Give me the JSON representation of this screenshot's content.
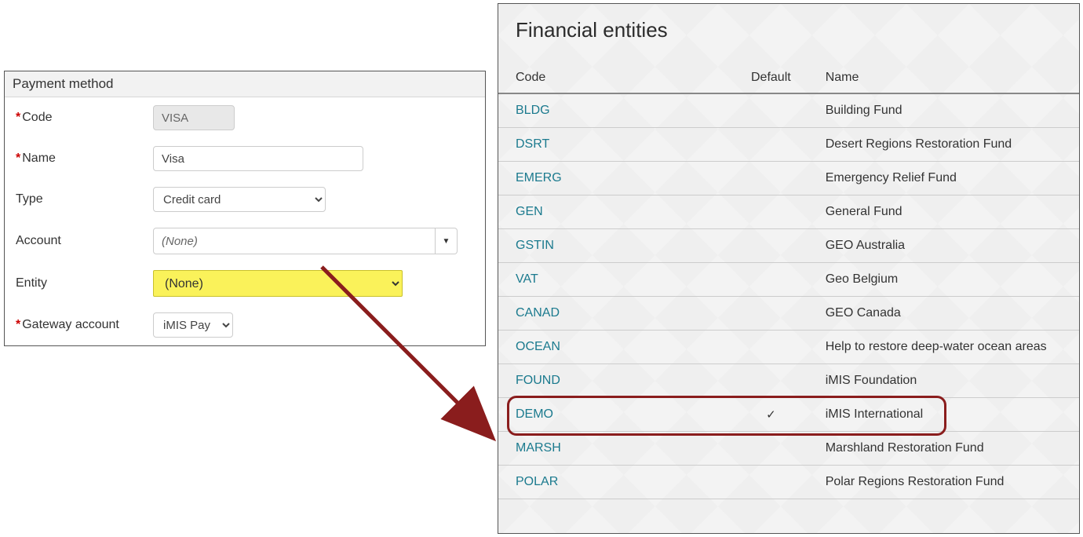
{
  "payment_panel": {
    "title": "Payment method",
    "labels": {
      "code": "Code",
      "name": "Name",
      "type": "Type",
      "account": "Account",
      "entity": "Entity",
      "gateway": "Gateway account"
    },
    "values": {
      "code": "VISA",
      "name": "Visa",
      "type": "Credit card",
      "account": "(None)",
      "entity": "(None)",
      "gateway": "iMIS Pay"
    }
  },
  "entities_panel": {
    "title": "Financial entities",
    "columns": {
      "code": "Code",
      "default": "Default",
      "name": "Name"
    },
    "rows": [
      {
        "code": "BLDG",
        "default": false,
        "name": "Building Fund"
      },
      {
        "code": "DSRT",
        "default": false,
        "name": "Desert Regions Restoration Fund"
      },
      {
        "code": "EMERG",
        "default": false,
        "name": "Emergency Relief Fund"
      },
      {
        "code": "GEN",
        "default": false,
        "name": "General Fund"
      },
      {
        "code": "GSTIN",
        "default": false,
        "name": "GEO Australia"
      },
      {
        "code": "VAT",
        "default": false,
        "name": "Geo Belgium"
      },
      {
        "code": "CANAD",
        "default": false,
        "name": "GEO Canada"
      },
      {
        "code": "OCEAN",
        "default": false,
        "name": "Help to restore deep-water ocean areas"
      },
      {
        "code": "FOUND",
        "default": false,
        "name": "iMIS Foundation"
      },
      {
        "code": "DEMO",
        "default": true,
        "name": "iMIS International",
        "highlight": true
      },
      {
        "code": "MARSH",
        "default": false,
        "name": "Marshland Restoration Fund"
      },
      {
        "code": "POLAR",
        "default": false,
        "name": "Polar Regions Restoration Fund"
      }
    ],
    "check_glyph": "✓"
  }
}
